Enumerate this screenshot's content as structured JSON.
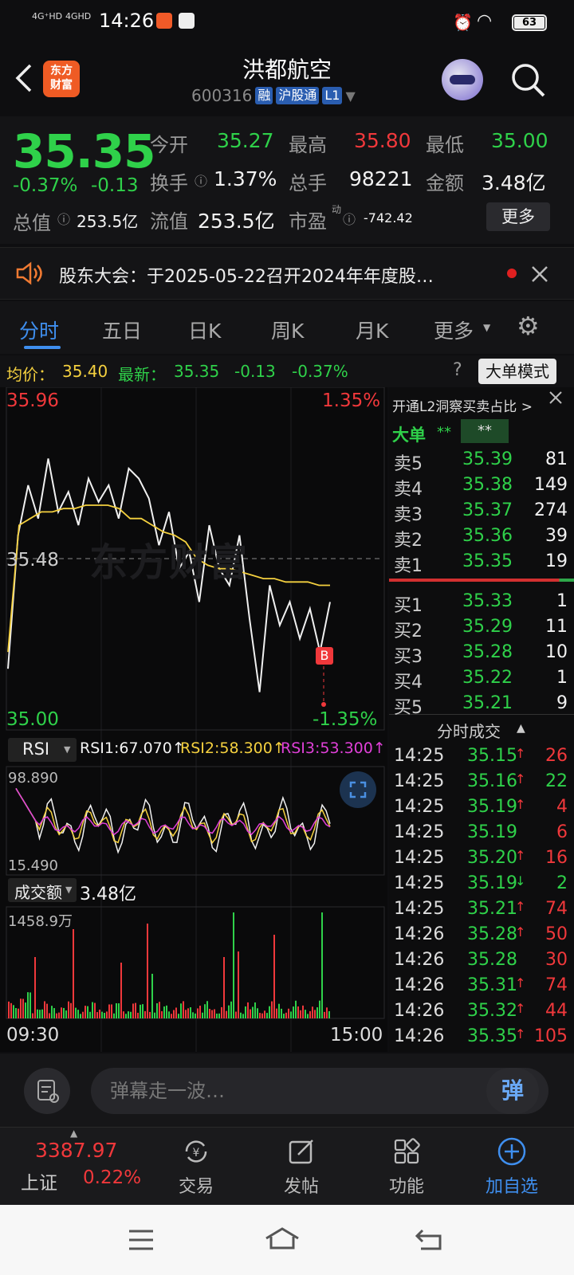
{
  "status_bar": {
    "signal1": "4G⁺HD",
    "signal2": "4GHD",
    "time": "14:26",
    "battery": "63"
  },
  "header": {
    "logo_line1": "东方",
    "logo_line2": "财富",
    "stock_name": "洪都航空",
    "stock_code": "600316",
    "tags": [
      "融",
      "沪股通",
      "L1"
    ]
  },
  "quote": {
    "price": "35.35",
    "change_pct": "-0.37%",
    "change": "-0.13",
    "open_label": "今开",
    "open": "35.27",
    "high_label": "最高",
    "high": "35.80",
    "low_label": "最低",
    "low": "35.00",
    "turnover_label": "换手",
    "turnover": "1.37%",
    "volume_label": "总手",
    "volume": "98221",
    "amount_label": "金额",
    "amount": "3.48亿",
    "mktcap_label": "总值",
    "mktcap": "253.5亿",
    "float_label": "流值",
    "float": "253.5亿",
    "pe_label": "市盈",
    "pe_sup": "动",
    "pe": "-742.42",
    "more_button": "更多"
  },
  "notice": {
    "text": "股东大会：于2025-05-22召开2024年年度股…"
  },
  "tabs": [
    "分时",
    "五日",
    "日K",
    "周K",
    "月K",
    "更多"
  ],
  "infobar": {
    "avg_label": "均价：",
    "avg": "35.40",
    "latest_label": "最新：",
    "latest": "35.35",
    "change": "-0.13",
    "change_pct": "-0.37%",
    "mode_button": "大单模式"
  },
  "chart": {
    "max_price": "35.96",
    "max_pct": "1.35%",
    "mid_price": "35.48",
    "min_price": "35.00",
    "min_pct": "-1.35%",
    "marker": "B",
    "rsi_selector": "RSI",
    "rsi1": "RSI1:67.070↑",
    "rsi2": "RSI2:58.300↑",
    "rsi3": "RSI3:53.300↑",
    "rsi_max": "98.890",
    "rsi_min": "15.490",
    "vol_selector": "成交额",
    "vol_total": "3.48亿",
    "vol_max": "1458.9万",
    "time_start": "09:30",
    "time_end": "15:00",
    "watermark": "东方财富"
  },
  "chart_data": {
    "type": "line",
    "title": "",
    "xlabel": "",
    "ylabel": "",
    "ylim": [
      35.0,
      35.96
    ],
    "prev_close": 35.48,
    "series": [
      {
        "values": [
          35.15,
          35.55,
          35.7,
          35.6,
          35.78,
          35.62,
          35.68,
          35.58,
          35.72,
          35.65,
          35.7,
          35.6,
          35.75,
          35.72,
          35.66,
          35.52,
          35.62,
          35.45,
          35.5,
          35.35,
          35.58,
          35.45,
          35.4,
          35.55,
          35.3,
          35.08,
          35.4,
          35.28,
          35.35,
          35.24,
          35.33,
          35.2,
          35.35
        ]
      },
      {
        "values": [
          35.2,
          35.58,
          35.6,
          35.62,
          35.62,
          35.63,
          35.63,
          35.64,
          35.64,
          35.64,
          35.63,
          35.6,
          35.6,
          35.58,
          35.56,
          35.55,
          35.53,
          35.48,
          35.46,
          35.45,
          35.45,
          35.44,
          35.43,
          35.42,
          35.42,
          35.41,
          35.41,
          35.41,
          35.4,
          35.4
        ]
      }
    ]
  },
  "orderbook": {
    "promo": "开通L2洞察买卖占比 >",
    "big_label": "大单",
    "big_v1": "**",
    "big_v2": "**",
    "asks": [
      {
        "label": "卖5",
        "price": "35.39",
        "vol": "81"
      },
      {
        "label": "卖4",
        "price": "35.38",
        "vol": "149"
      },
      {
        "label": "卖3",
        "price": "35.37",
        "vol": "274"
      },
      {
        "label": "卖2",
        "price": "35.36",
        "vol": "39"
      },
      {
        "label": "卖1",
        "price": "35.35",
        "vol": "19"
      }
    ],
    "bids": [
      {
        "label": "买1",
        "price": "35.33",
        "vol": "1"
      },
      {
        "label": "买2",
        "price": "35.29",
        "vol": "11"
      },
      {
        "label": "买3",
        "price": "35.28",
        "vol": "10"
      },
      {
        "label": "买4",
        "price": "35.22",
        "vol": "1"
      },
      {
        "label": "买5",
        "price": "35.21",
        "vol": "9"
      }
    ],
    "ticks_title": "分时成交",
    "ticks": [
      {
        "time": "14:25",
        "price": "35.15",
        "arrow": "↑",
        "vol": "26",
        "dir": "up"
      },
      {
        "time": "14:25",
        "price": "35.16",
        "arrow": "↑",
        "vol": "22",
        "dir": "down"
      },
      {
        "time": "14:25",
        "price": "35.19",
        "arrow": "↑",
        "vol": "4",
        "dir": "up"
      },
      {
        "time": "14:25",
        "price": "35.19",
        "arrow": "",
        "vol": "6",
        "dir": "up"
      },
      {
        "time": "14:25",
        "price": "35.20",
        "arrow": "↑",
        "vol": "16",
        "dir": "up"
      },
      {
        "time": "14:25",
        "price": "35.19",
        "arrow": "↓",
        "vol": "2",
        "dir": "down"
      },
      {
        "time": "14:25",
        "price": "35.21",
        "arrow": "↑",
        "vol": "74",
        "dir": "up"
      },
      {
        "time": "14:26",
        "price": "35.28",
        "arrow": "↑",
        "vol": "50",
        "dir": "up"
      },
      {
        "time": "14:26",
        "price": "35.28",
        "arrow": "",
        "vol": "30",
        "dir": "up"
      },
      {
        "time": "14:26",
        "price": "35.31",
        "arrow": "↑",
        "vol": "74",
        "dir": "up"
      },
      {
        "time": "14:26",
        "price": "35.32",
        "arrow": "↑",
        "vol": "44",
        "dir": "up"
      },
      {
        "time": "14:26",
        "price": "35.35",
        "arrow": "↑",
        "vol": "105",
        "dir": "up"
      }
    ]
  },
  "danmu": {
    "icon_label": "弹",
    "placeholder": "弹幕走一波…"
  },
  "bottom_nav": {
    "index_value": "3387.97",
    "index_name": "上证",
    "index_change": "0.22%",
    "items": [
      "交易",
      "发帖",
      "功能",
      "加自选"
    ]
  },
  "colors": {
    "up": "#f0383b",
    "down": "#2fd14a",
    "accent": "#3f8fef",
    "avg_line": "#f4d03f"
  }
}
